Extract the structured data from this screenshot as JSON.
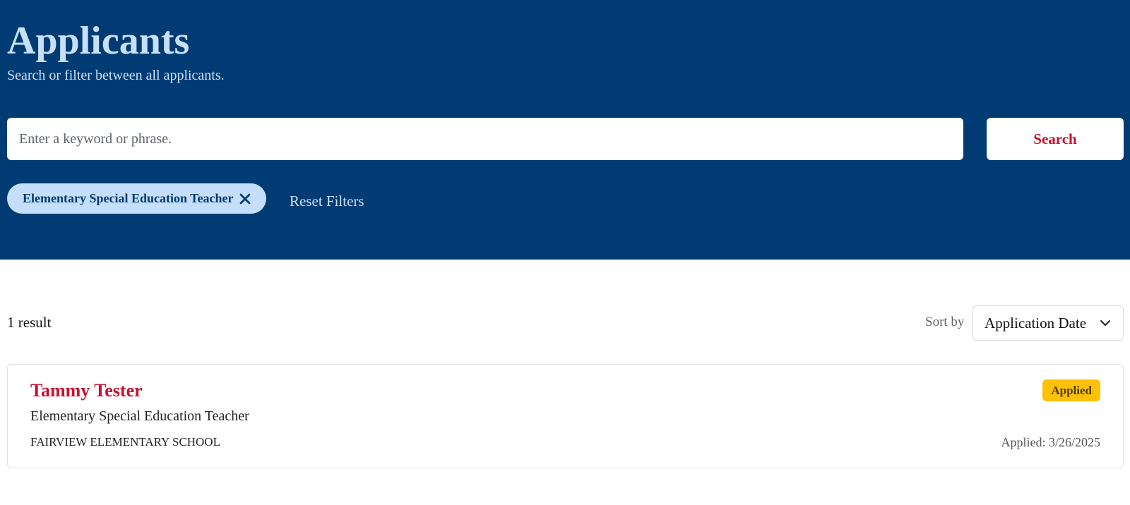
{
  "header": {
    "title": "Applicants",
    "subtitle": "Search or filter between all applicants."
  },
  "search": {
    "placeholder": "Enter a keyword or phrase.",
    "value": "",
    "button_label": "Search"
  },
  "filters": {
    "active": [
      {
        "label": "Elementary Special Education Teacher",
        "icon": "close-icon"
      }
    ],
    "reset_label": "Reset Filters"
  },
  "results": {
    "count_text": "1 result",
    "sort_label": "Sort by",
    "sort_value": "Application Date",
    "items": [
      {
        "name": "Tammy Tester",
        "position": "Elementary Special Education Teacher",
        "school": "FAIRVIEW ELEMENTARY SCHOOL",
        "status": "Applied",
        "applied_text": "Applied: 3/26/2025"
      }
    ]
  },
  "colors": {
    "header_bg": "#003b73",
    "header_text": "#c8e0f7",
    "accent_red": "#c8102e",
    "chip_bg": "#c5defa",
    "status_applied": "#ffc107"
  }
}
